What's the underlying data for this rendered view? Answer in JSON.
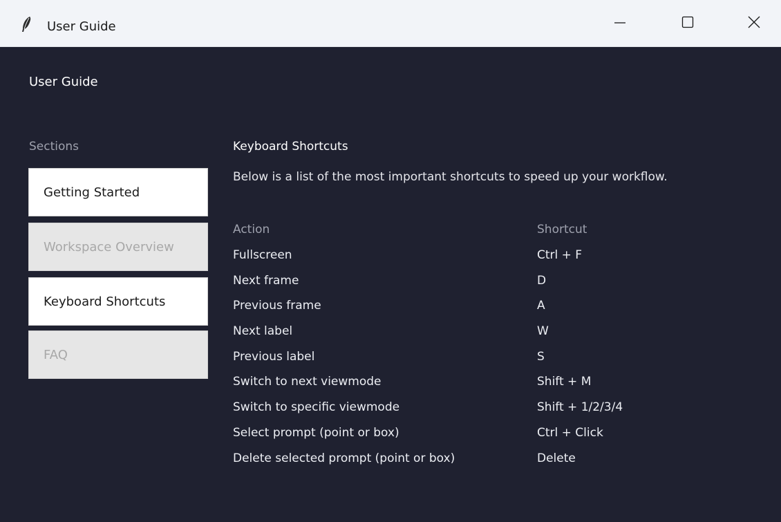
{
  "titlebar": {
    "title": "User Guide",
    "icon": "feather-icon",
    "controls": {
      "minimize": "minimize-icon",
      "maximize": "maximize-icon",
      "close": "close-icon"
    }
  },
  "heading": "User Guide",
  "sidebar": {
    "label": "Sections",
    "items": [
      {
        "label": "Getting Started",
        "state": "active"
      },
      {
        "label": "Workspace Overview",
        "state": "inactive"
      },
      {
        "label": "Keyboard Shortcuts",
        "state": "active"
      },
      {
        "label": "FAQ",
        "state": "inactive"
      }
    ]
  },
  "content": {
    "title": "Keyboard Shortcuts",
    "description": "Below is a list of the most important shortcuts to speed up your workflow.",
    "table": {
      "headers": {
        "action": "Action",
        "shortcut": "Shortcut"
      },
      "rows": [
        {
          "action": "Fullscreen",
          "shortcut": "Ctrl + F"
        },
        {
          "action": "Next frame",
          "shortcut": "D"
        },
        {
          "action": "Previous frame",
          "shortcut": "A"
        },
        {
          "action": "Next label",
          "shortcut": "W"
        },
        {
          "action": "Previous label",
          "shortcut": "S"
        },
        {
          "action": "Switch to next viewmode",
          "shortcut": "Shift + M"
        },
        {
          "action": "Switch to specific viewmode",
          "shortcut": "Shift + 1/2/3/4"
        },
        {
          "action": "Select prompt (point or box)",
          "shortcut": "Ctrl + Click"
        },
        {
          "action": "Delete selected prompt (point or box)",
          "shortcut": "Delete"
        }
      ]
    }
  },
  "colors": {
    "background": "#1f2130",
    "titlebar": "#f2f4f8",
    "button_active": "#ffffff",
    "button_inactive": "#e6e6e6",
    "muted_text": "#9ea1ad"
  }
}
